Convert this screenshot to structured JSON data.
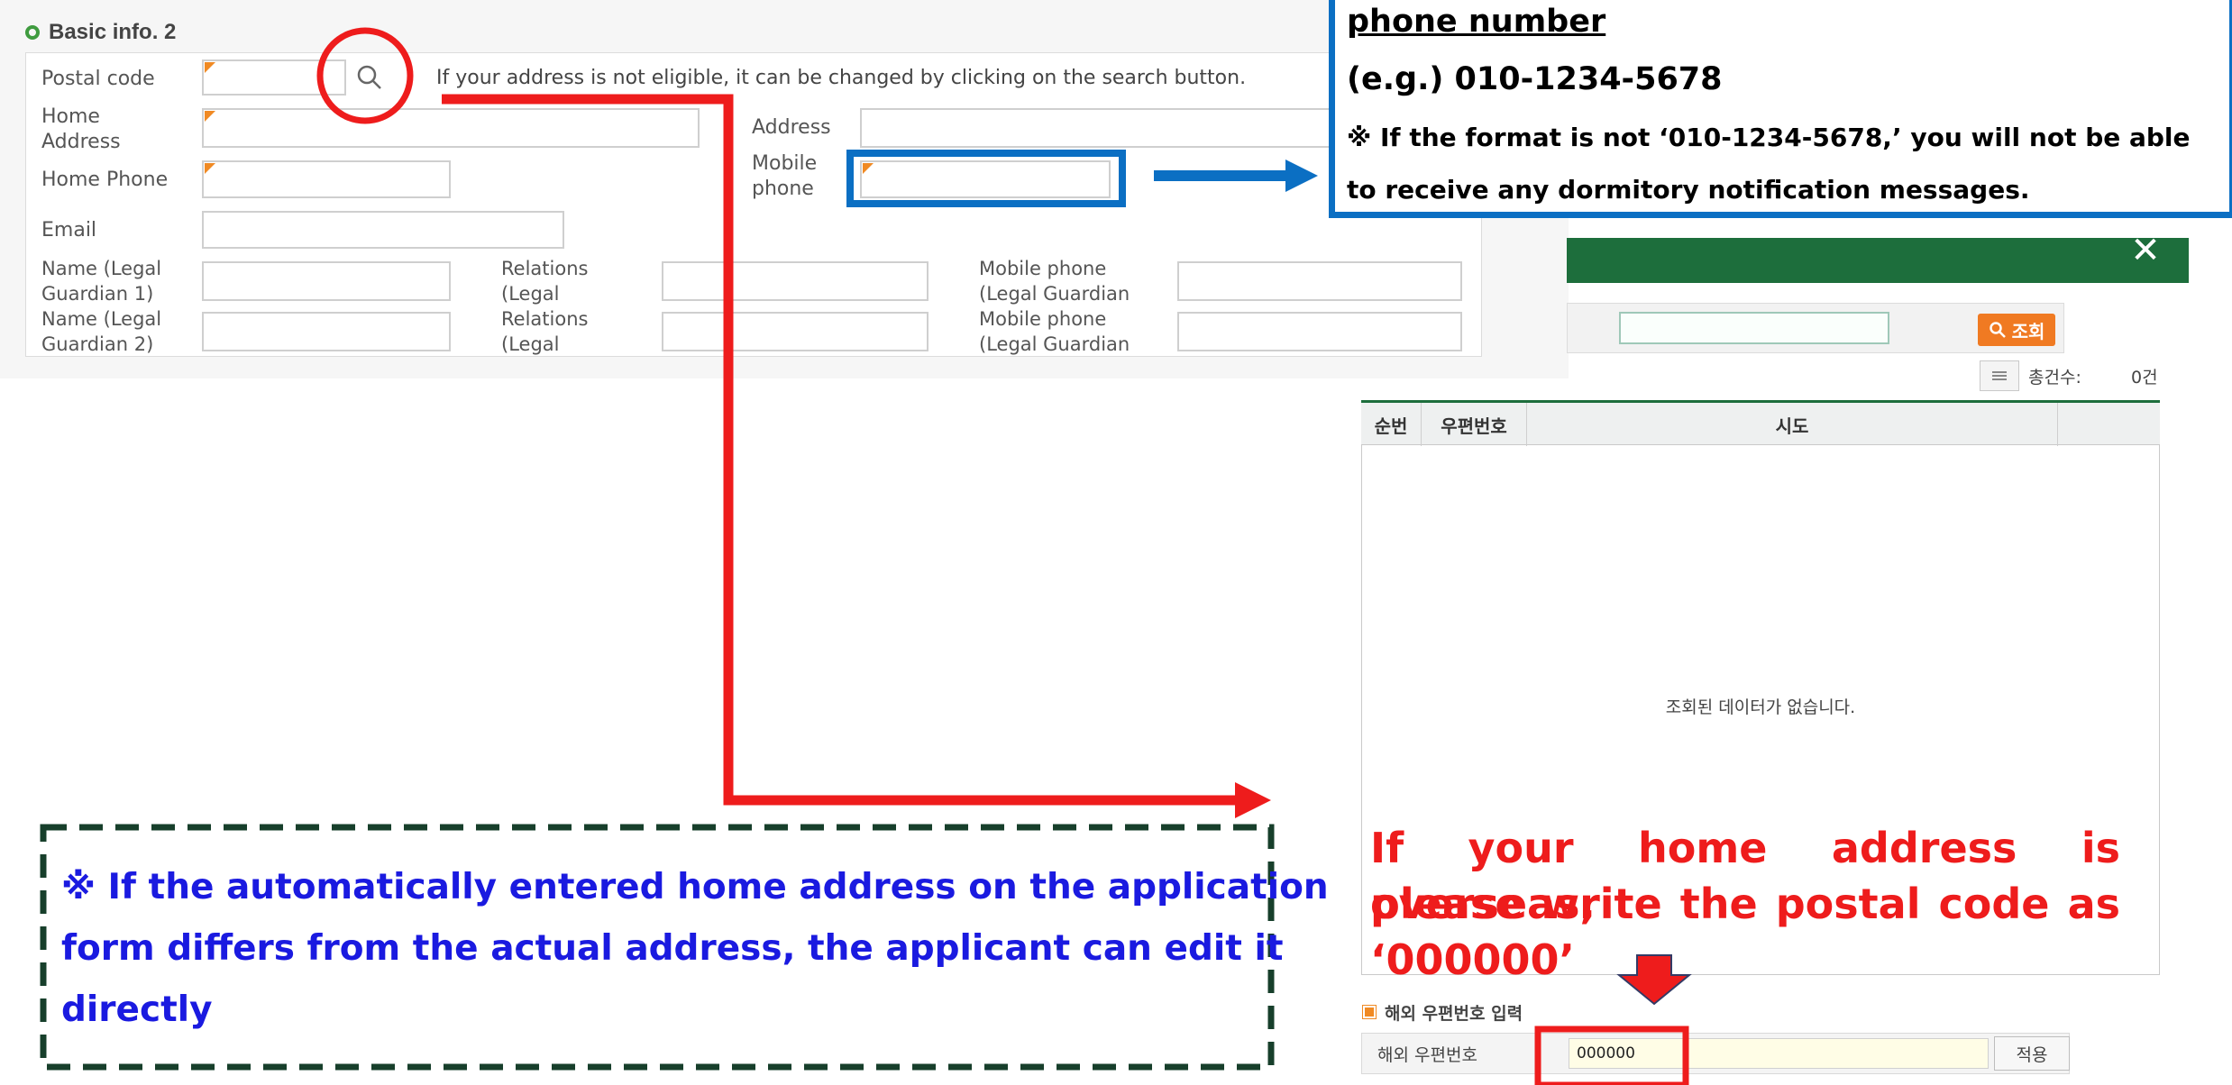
{
  "form": {
    "section_title": "Basic info. 2",
    "labels": {
      "postal_code": "Postal code",
      "home_address": "Home Address",
      "address": "Address",
      "home_phone": "Home Phone",
      "mobile_phone": "Mobile phone",
      "email": "Email",
      "guardian1_name": "Name (Legal Guardian 1)",
      "guardian1_relation": "Relations (Legal",
      "guardian1_mobile": "Mobile phone (Legal Guardian",
      "guardian2_name": "Name (Legal Guardian 2)",
      "guardian2_relation": "Relations (Legal",
      "guardian2_mobile": "Mobile phone (Legal Guardian"
    },
    "postal_hint": "If your address is not eligible, it can be changed by clicking on the search button."
  },
  "phone_note": {
    "heading": "phone number",
    "example": "(e.g.) 010-1234-5678",
    "warning_line1": "※ If the format is not ‘010-1234-5678,’ you will not be able",
    "warning_line2": "to receive any dormitory notification messages."
  },
  "popup": {
    "close_label": "✕",
    "search_button": "조회",
    "total_label": "총건수:",
    "total_count": "0건",
    "columns": [
      "순번",
      "우편번호",
      "시도"
    ],
    "empty_message": "조회된 데이터가 없습니다.",
    "overseas_section_title": "해외 우편번호 입력",
    "overseas_label": "해외 우편번호",
    "overseas_value": "000000",
    "apply_button": "적용"
  },
  "annotations": {
    "overseas_note_line1": "If your home address is overseas,",
    "overseas_note_line2": "please write the postal code as",
    "overseas_note_line3": "‘000000’",
    "edit_note_line1": "※ If the automatically entered home address on the application",
    "edit_note_line2": "form differs from the actual address, the applicant can edit it",
    "edit_note_line3": "directly"
  },
  "colors": {
    "annotation_red": "#ee1c1c",
    "annotation_blue": "#0b6fc3",
    "popup_green": "#1d6e3c",
    "orange_button": "#f07a22",
    "note_text_blue": "#1a1ae0",
    "dashed_border": "#173f2b"
  },
  "icons": {
    "search": "magnifier-icon",
    "close": "close-icon",
    "list": "list-icon",
    "section_marker": "ring-icon"
  }
}
